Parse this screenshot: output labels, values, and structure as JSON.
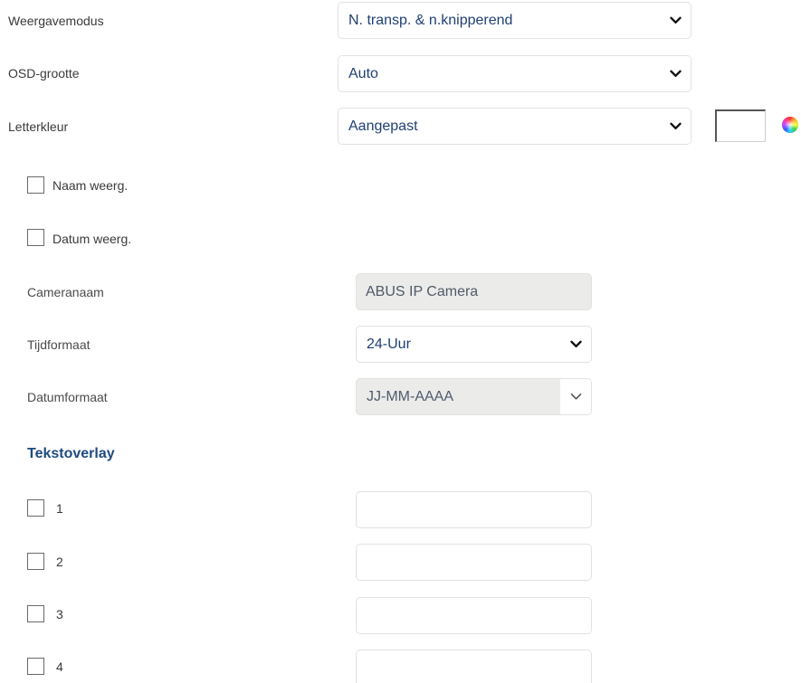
{
  "display": {
    "mode_label": "Weergavemodus",
    "mode_value": "N. transp. & n.knipperend",
    "osd_size_label": "OSD-grootte",
    "osd_size_value": "Auto",
    "font_color_label": "Letterkleur",
    "font_color_value": "Aangepast",
    "font_color_swatch": "#ffffff"
  },
  "toggles": {
    "show_name_label": "Naam weerg.",
    "show_date_label": "Datum weerg."
  },
  "camera": {
    "name_label": "Cameranaam",
    "name_value": "ABUS IP Camera",
    "time_format_label": "Tijdformaat",
    "time_format_value": "24-Uur",
    "date_format_label": "Datumformaat",
    "date_format_value": "JJ-MM-AAAA"
  },
  "text_overlay": {
    "title": "Tekstoverlay",
    "items": [
      {
        "label": "1",
        "value": ""
      },
      {
        "label": "2",
        "value": ""
      },
      {
        "label": "3",
        "value": ""
      },
      {
        "label": "4",
        "value": ""
      }
    ]
  },
  "icons": {
    "dropdown": "chevron-down-icon",
    "color_picker": "color-wheel-icon"
  },
  "colors": {
    "accent": "#1f4a80",
    "value_text": "#1f3f73",
    "disabled_bg": "#ebebea"
  }
}
